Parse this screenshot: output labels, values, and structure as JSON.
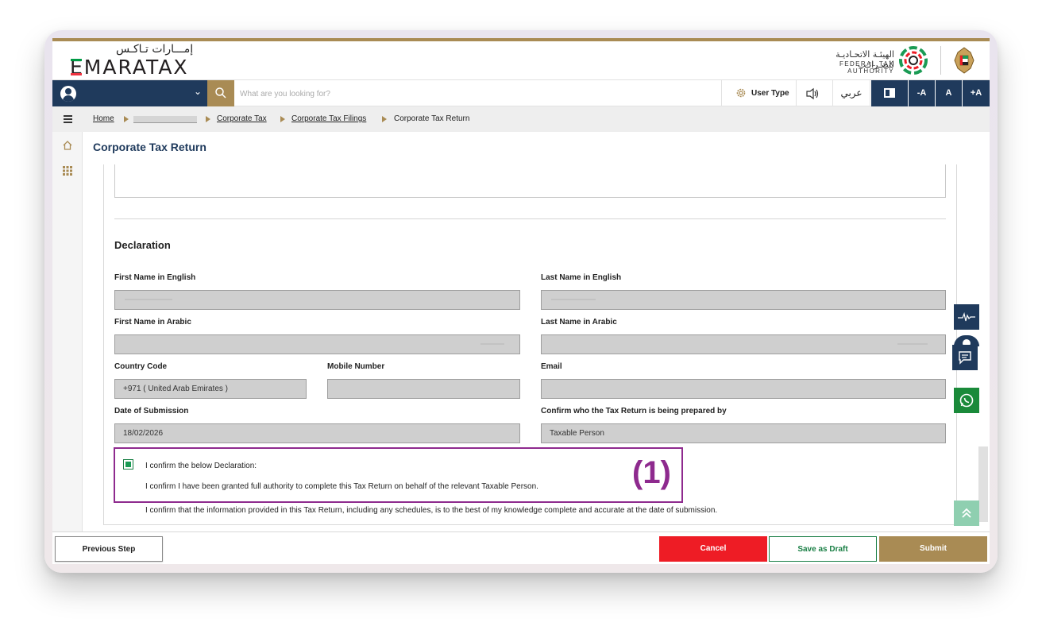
{
  "brand": {
    "logo_ar": "إمـــارات تـاكـس",
    "logo_e": "E",
    "logo_rest": "MARATAX",
    "authority_ar": "الهيئـة الاتحـاديـة للضـرائـب",
    "authority_en": "FEDERAL TAX AUTHORITY",
    "accent_color": "#a98b54",
    "navy": "#1f3a5c"
  },
  "toolbar": {
    "search_placeholder": "What are you looking for?",
    "user_type_label": "User Type",
    "lang_label": "عربي",
    "font_decrease": "-A",
    "font_default": "A",
    "font_increase": "+A"
  },
  "breadcrumb": {
    "home": "Home",
    "corporate_tax": "Corporate Tax",
    "filings": "Corporate Tax Filings",
    "current": "Corporate Tax Return"
  },
  "page": {
    "title": "Corporate Tax Return"
  },
  "declaration": {
    "title": "Declaration",
    "first_name_en_label": "First Name in English",
    "last_name_en_label": "Last Name in English",
    "first_name_ar_label": "First Name in Arabic",
    "last_name_ar_label": "Last Name in Arabic",
    "country_code_label": "Country Code",
    "country_code_value": "+971 ( United Arab Emirates )",
    "mobile_label": "Mobile Number",
    "email_label": "Email",
    "date_label": "Date of Submission",
    "date_value": "18/02/2026",
    "prepared_by_label": "Confirm who the Tax Return is being prepared by",
    "prepared_by_value": "Taxable Person",
    "confirm_checked": true,
    "confirm_line1": "I confirm the below Declaration:",
    "confirm_line2": "I confirm I have been granted full authority to complete this Tax Return on behalf of the relevant Taxable Person.",
    "confirm_line3": "I confirm that the information provided in this Tax Return, including any schedules, is to the best of my knowledge complete and accurate at the date of submission.",
    "marker": "(1)"
  },
  "footer": {
    "previous": "Previous Step",
    "cancel": "Cancel",
    "save_draft": "Save as Draft",
    "submit": "Submit"
  }
}
